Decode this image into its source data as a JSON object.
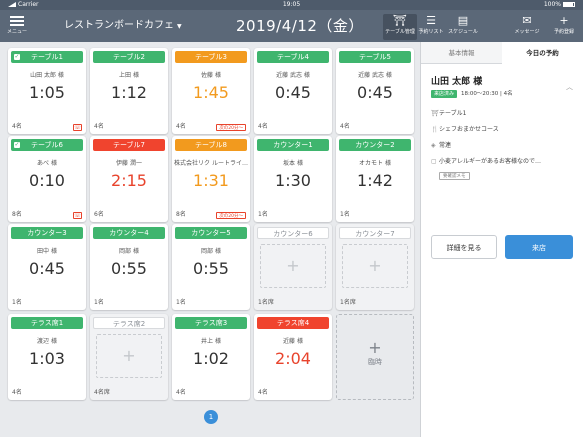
{
  "statusbar": {
    "carrier": "Carrier",
    "time": "19:05",
    "battery": "100%"
  },
  "nav": {
    "menu_label": "メニュー",
    "shop_name": "レストランボードカフェ",
    "date": "2019/4/12（金）",
    "tools": [
      {
        "label": "テーブル管理",
        "icon": "table-icon",
        "glyph": "⛩"
      },
      {
        "label": "予約リスト",
        "icon": "list-icon",
        "glyph": "☰"
      },
      {
        "label": "スケジュール",
        "icon": "schedule-icon",
        "glyph": "▤"
      },
      {
        "label": "メッセージ",
        "icon": "mail-icon",
        "glyph": "✉"
      },
      {
        "label": "予約登録",
        "icon": "plus-icon",
        "glyph": "+"
      }
    ]
  },
  "cards": [
    {
      "label": "テーブル1",
      "color": "green",
      "check": true,
      "name": "山田 太郎 様",
      "time": "1:05",
      "time_color": "",
      "count": "4名",
      "phone": true
    },
    {
      "label": "テーブル2",
      "color": "green",
      "name": "上田 様",
      "time": "1:12",
      "time_color": "",
      "count": "4名"
    },
    {
      "label": "テーブル3",
      "color": "orange",
      "name": "佐藤 様",
      "time": "1:45",
      "time_color": "orange",
      "count": "4名",
      "badge": "次の20分〜"
    },
    {
      "label": "テーブル4",
      "color": "green",
      "name": "近藤 武志 様",
      "time": "0:45",
      "time_color": "",
      "count": "4名"
    },
    {
      "label": "テーブル5",
      "color": "green",
      "name": "近藤 武志 様",
      "time": "0:45",
      "time_color": "",
      "count": "4名"
    },
    {
      "label": "テーブル6",
      "color": "green",
      "check": true,
      "name": "あべ 様",
      "time": "0:10",
      "time_color": "",
      "count": "8名",
      "phone": true
    },
    {
      "label": "テーブル7",
      "color": "red",
      "name": "伊藤 潤一",
      "time": "2:15",
      "time_color": "red",
      "count": "6名"
    },
    {
      "label": "テーブル8",
      "color": "orange",
      "name": "株式会社リク ルートライ…",
      "time": "1:31",
      "time_color": "orange",
      "count": "8名",
      "badge": "次の20分〜"
    },
    {
      "label": "カウンター1",
      "color": "green",
      "name": "坂本 様",
      "time": "1:30",
      "time_color": "",
      "count": "1名"
    },
    {
      "label": "カウンター2",
      "color": "green",
      "name": "オカモト 様",
      "time": "1:42",
      "time_color": "",
      "count": "1名"
    },
    {
      "label": "カウンター3",
      "color": "green",
      "name": "田中 様",
      "time": "0:45",
      "time_color": "",
      "count": "1名"
    },
    {
      "label": "カウンター4",
      "color": "green",
      "name": "岡部 様",
      "time": "0:55",
      "time_color": "",
      "count": "1名"
    },
    {
      "label": "カウンター5",
      "color": "green",
      "name": "岡部 様",
      "time": "0:55",
      "time_color": "",
      "count": "1名"
    },
    {
      "label": "カウンター6",
      "color": "gray",
      "empty": true,
      "count": "1名席"
    },
    {
      "label": "カウンター7",
      "color": "gray",
      "empty": true,
      "count": "1名席"
    },
    {
      "label": "テラス席1",
      "color": "green",
      "name": "渡辺 様",
      "time": "1:03",
      "time_color": "",
      "count": "4名"
    },
    {
      "label": "テラス席2",
      "color": "gray",
      "empty": true,
      "count": "4名席"
    },
    {
      "label": "テラス席3",
      "color": "green",
      "name": "井上 様",
      "time": "1:02",
      "time_color": "",
      "count": "4名"
    },
    {
      "label": "テラス席4",
      "color": "red",
      "name": "近藤 様",
      "time": "2:04",
      "time_color": "red",
      "count": "4名"
    }
  ],
  "adhoc_label": "臨時",
  "page_number": "1",
  "panel": {
    "tab_info": "基本情報",
    "tab_today": "今日の予約",
    "guest": "山田 太郎 様",
    "status": "来店済み",
    "time_range": "18:00〜20:30",
    "party": "4名",
    "table": "テーブル1",
    "course": "シェフおまかせコース",
    "tag": "常連",
    "note": "小麦アレルギーがあるお客様なので…",
    "note_tag": "要確認メモ",
    "detail_button": "詳細を見る",
    "visit_button": "来店"
  },
  "colors": {
    "green": "#3fb56e",
    "orange": "#f29a1e",
    "red": "#f0442e",
    "blue": "#3a8fd9",
    "navbar": "#5b6878"
  }
}
